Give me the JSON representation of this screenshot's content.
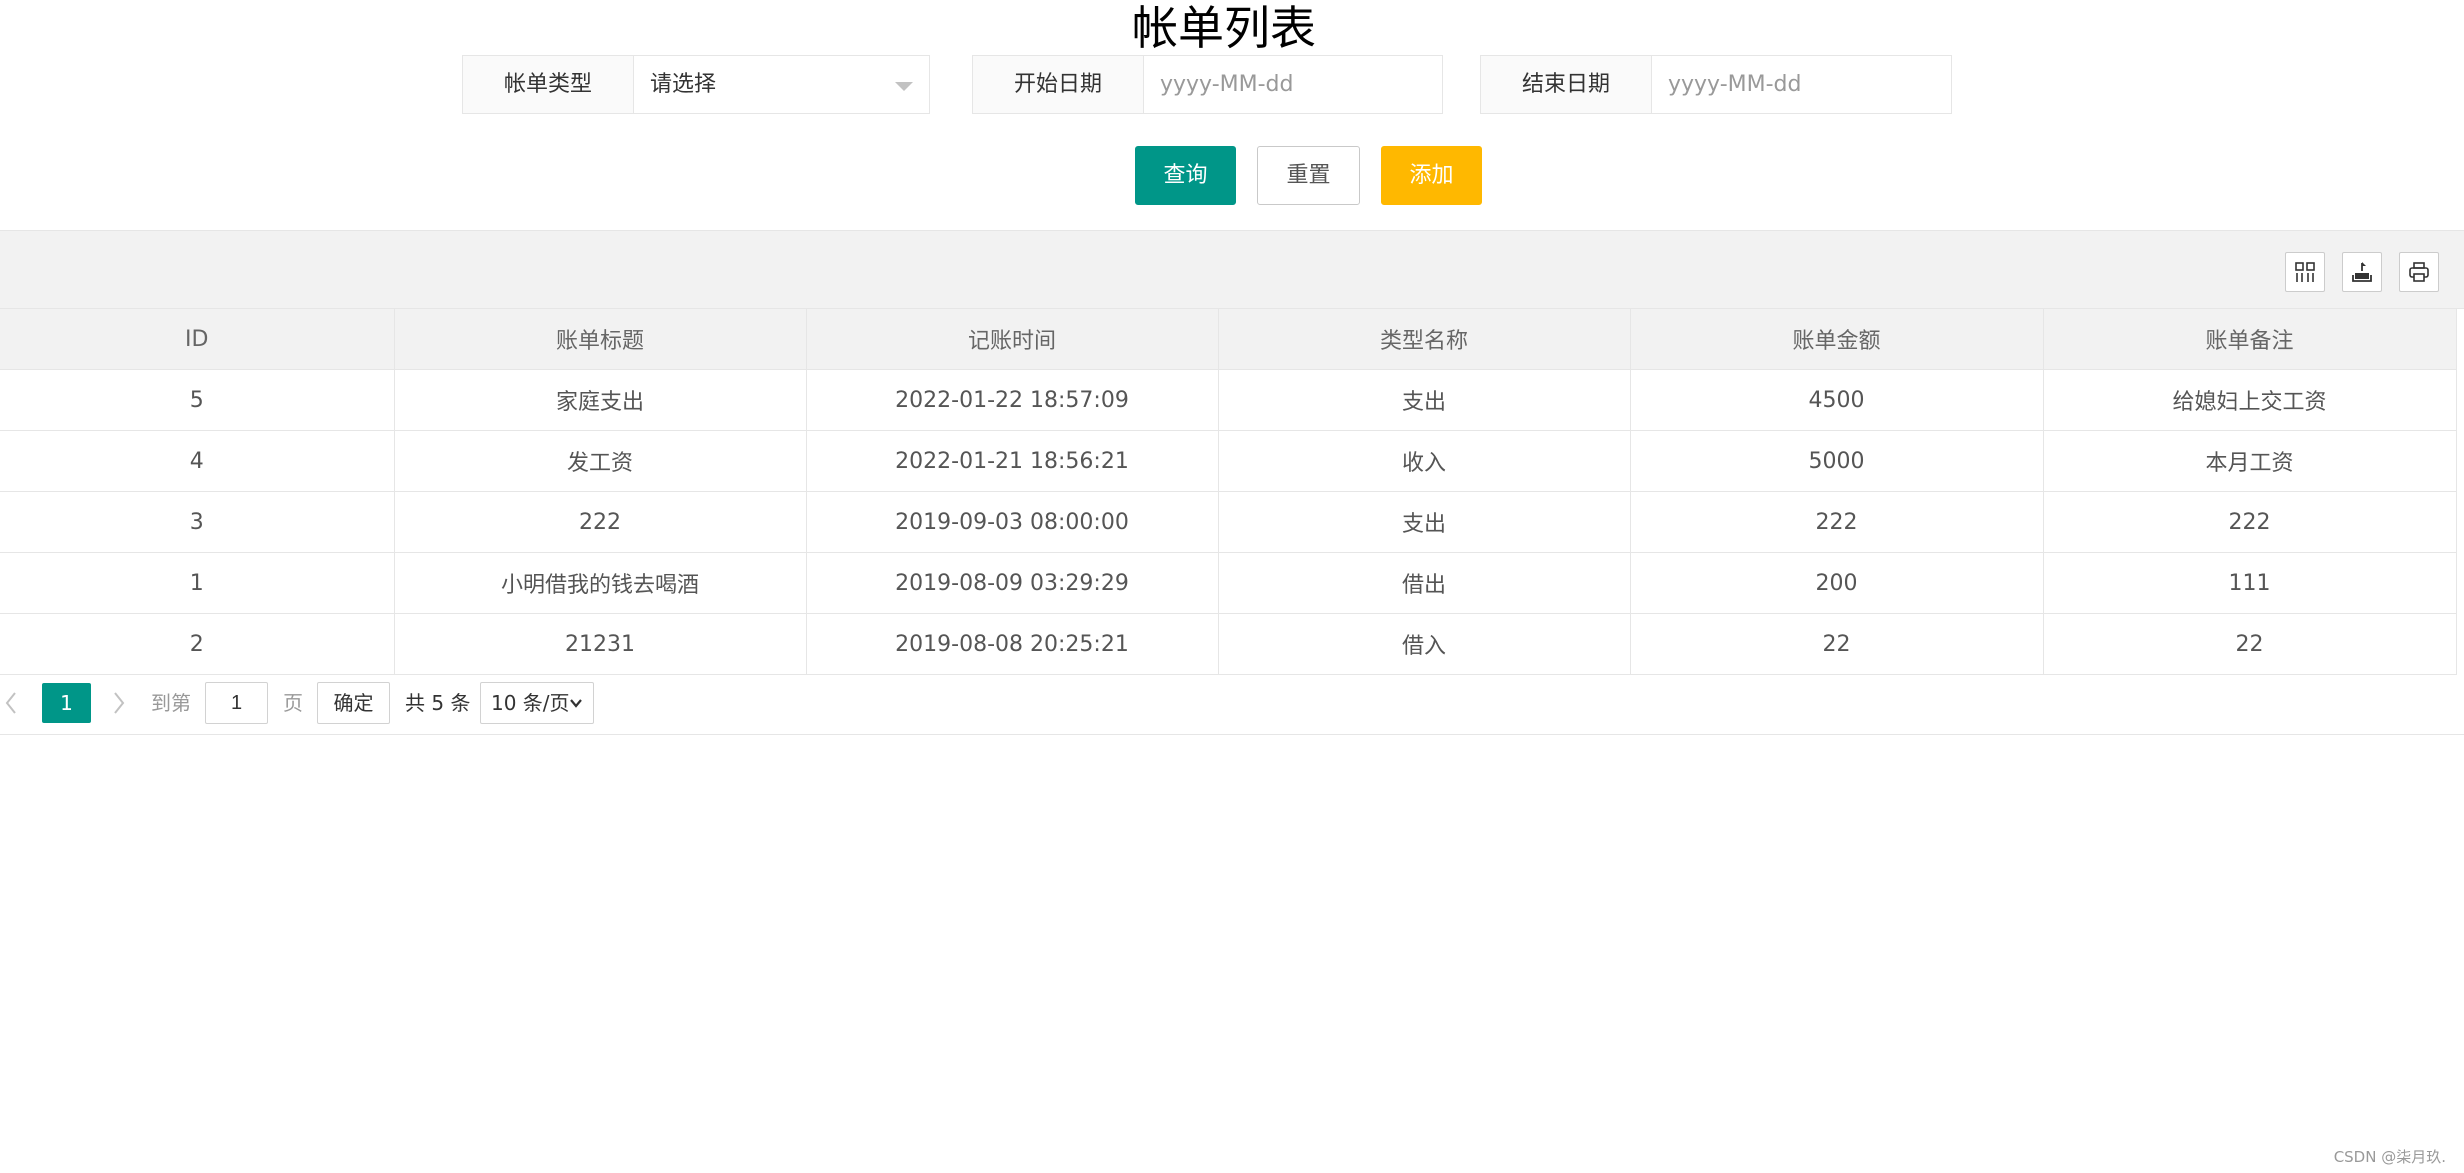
{
  "page": {
    "title": "帐单列表"
  },
  "filters": {
    "bill_type": {
      "label": "帐单类型",
      "selected": "请选择"
    },
    "start_date": {
      "label": "开始日期",
      "placeholder": "yyyy-MM-dd"
    },
    "end_date": {
      "label": "结束日期",
      "placeholder": "yyyy-MM-dd"
    }
  },
  "actions": {
    "search_label": "查询",
    "reset_label": "重置",
    "add_label": "添加"
  },
  "toolbar": {
    "icons": [
      "columns-filter-icon",
      "export-icon",
      "print-icon"
    ]
  },
  "table": {
    "headers": [
      "ID",
      "账单标题",
      "记账时间",
      "类型名称",
      "账单金额",
      "账单备注"
    ],
    "rows": [
      [
        "5",
        "家庭支出",
        "2022-01-22 18:57:09",
        "支出",
        "4500",
        "给媳妇上交工资"
      ],
      [
        "4",
        "发工资",
        "2022-01-21 18:56:21",
        "收入",
        "5000",
        "本月工资"
      ],
      [
        "3",
        "222",
        "2019-09-03 08:00:00",
        "支出",
        "222",
        "222"
      ],
      [
        "1",
        "小明借我的钱去喝酒",
        "2019-08-09 03:29:29",
        "借出",
        "200",
        "111"
      ],
      [
        "2",
        "21231",
        "2019-08-08 20:25:21",
        "借入",
        "22",
        "22"
      ]
    ]
  },
  "pagination": {
    "current_page": "1",
    "goto_label": "到第",
    "goto_value": "1",
    "page_unit": "页",
    "confirm_label": "确定",
    "total_text": "共 5 条",
    "limit_value": "10 条/页"
  },
  "colors": {
    "primary": "#009688",
    "warm": "#ffb800",
    "header_bg": "#f2f2f2",
    "border": "#e6e6e6"
  },
  "watermark": "CSDN @柒月玖."
}
